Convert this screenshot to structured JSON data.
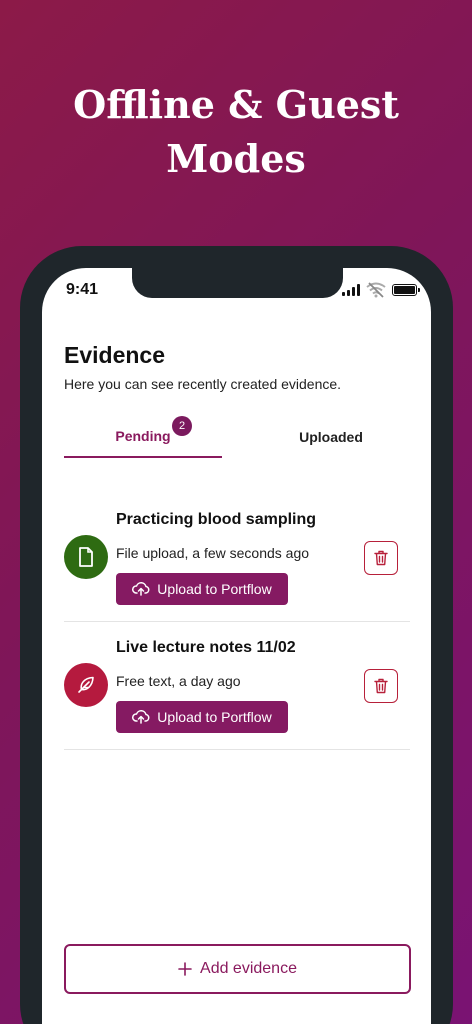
{
  "hero": {
    "title": "Offline & Guest Modes"
  },
  "status_bar": {
    "time": "9:41"
  },
  "page": {
    "title": "Evidence",
    "subtitle": "Here you can see recently created evidence."
  },
  "tabs": [
    {
      "label": "Pending",
      "badge": "2",
      "active": true
    },
    {
      "label": "Uploaded",
      "active": false
    }
  ],
  "evidence_items": [
    {
      "title": "Practicing blood sampling",
      "meta": "File upload, a few seconds ago",
      "icon": "file-icon",
      "icon_color": "#2e6b12",
      "upload_label": "Upload to Portflow"
    },
    {
      "title": "Live lecture notes 11/02",
      "meta": "Free text, a day ago",
      "icon": "feather-icon",
      "icon_color": "#b51a3e",
      "upload_label": "Upload to Portflow"
    }
  ],
  "add_button": {
    "label": "Add evidence"
  },
  "colors": {
    "brand": "#851a62",
    "delete": "#b7203a",
    "background_start": "#8c1a48",
    "background_end": "#7a1373"
  }
}
